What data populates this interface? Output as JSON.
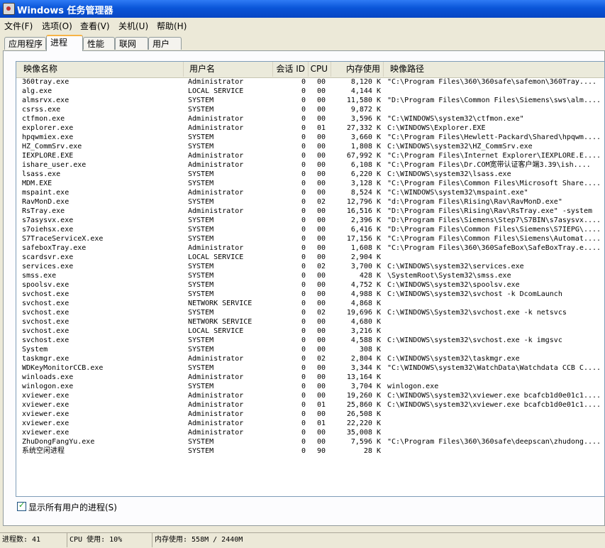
{
  "window": {
    "title": "Windows 任务管理器"
  },
  "menu": [
    "文件(F)",
    "选项(O)",
    "查看(V)",
    "关机(U)",
    "帮助(H)"
  ],
  "tabs": [
    "应用程序",
    "进程",
    "性能",
    "联网",
    "用户"
  ],
  "active_tab": "进程",
  "columns": [
    "映像名称",
    "用户名",
    "会话 ID",
    "CPU",
    "内存使用",
    "映像路径"
  ],
  "processes": [
    [
      "360tray.exe",
      "Administrator",
      "0",
      "00",
      "8,120 K",
      "\"C:\\Program Files\\360\\360safe\\safemon\\360Tray...."
    ],
    [
      "alg.exe",
      "LOCAL SERVICE",
      "0",
      "00",
      "4,144 K",
      ""
    ],
    [
      "almsrvx.exe",
      "SYSTEM",
      "0",
      "00",
      "11,580 K",
      "\"D:\\Program Files\\Common Files\\Siemens\\sws\\alm...."
    ],
    [
      "csrss.exe",
      "SYSTEM",
      "0",
      "00",
      "9,872 K",
      ""
    ],
    [
      "ctfmon.exe",
      "Administrator",
      "0",
      "00",
      "3,596 K",
      "\"C:\\WINDOWS\\system32\\ctfmon.exe\""
    ],
    [
      "explorer.exe",
      "Administrator",
      "0",
      "01",
      "27,332 K",
      "C:\\WINDOWS\\Explorer.EXE"
    ],
    [
      "hpqwmiex.exe",
      "SYSTEM",
      "0",
      "00",
      "3,660 K",
      "\"C:\\Program Files\\Hewlett-Packard\\Shared\\hpqwm...."
    ],
    [
      "HZ_CommSrv.exe",
      "SYSTEM",
      "0",
      "00",
      "1,808 K",
      "C:\\WINDOWS\\system32\\HZ_CommSrv.exe"
    ],
    [
      "IEXPLORE.EXE",
      "Administrator",
      "0",
      "00",
      "67,992 K",
      "\"C:\\Program Files\\Internet Explorer\\IEXPLORE.E...."
    ],
    [
      "ishare_user.exe",
      "Administrator",
      "0",
      "00",
      "6,108 K",
      "\"C:\\Program Files\\Dr.COM宽带认证客户端3.39\\ish...."
    ],
    [
      "lsass.exe",
      "SYSTEM",
      "0",
      "00",
      "6,220 K",
      "C:\\WINDOWS\\system32\\lsass.exe"
    ],
    [
      "MDM.EXE",
      "SYSTEM",
      "0",
      "00",
      "3,128 K",
      "\"C:\\Program Files\\Common Files\\Microsoft Share...."
    ],
    [
      "mspaint.exe",
      "Administrator",
      "0",
      "00",
      "8,524 K",
      "\"C:\\WINDOWS\\system32\\mspaint.exe\""
    ],
    [
      "RavMonD.exe",
      "SYSTEM",
      "0",
      "02",
      "12,796 K",
      "\"d:\\Program Files\\Rising\\Rav\\RavMonD.exe\""
    ],
    [
      "RsTray.exe",
      "Administrator",
      "0",
      "00",
      "16,516 K",
      "\"D:\\Program Files\\Rising\\Rav\\RsTray.exe\" -system"
    ],
    [
      "s7asysvx.exe",
      "SYSTEM",
      "0",
      "00",
      "2,396 K",
      "\"D:\\Program Files\\Siemens\\Step7\\S7BIN\\s7asysvx...."
    ],
    [
      "s7oiehsx.exe",
      "SYSTEM",
      "0",
      "00",
      "6,416 K",
      "\"D:\\Program Files\\Common Files\\Siemens\\S7IEPG\\...."
    ],
    [
      "S7TraceServiceX.exe",
      "SYSTEM",
      "0",
      "00",
      "17,156 K",
      "\"C:\\Program Files\\Common Files\\Siemens\\Automat...."
    ],
    [
      "safeboxTray.exe",
      "Administrator",
      "0",
      "00",
      "1,608 K",
      "\"C:\\Program Files\\360\\360SafeBox\\SafeBoxTray.e...."
    ],
    [
      "scardsvr.exe",
      "LOCAL SERVICE",
      "0",
      "00",
      "2,904 K",
      ""
    ],
    [
      "services.exe",
      "SYSTEM",
      "0",
      "02",
      "3,700 K",
      "C:\\WINDOWS\\system32\\services.exe"
    ],
    [
      "smss.exe",
      "SYSTEM",
      "0",
      "00",
      "428 K",
      "\\SystemRoot\\System32\\smss.exe"
    ],
    [
      "spoolsv.exe",
      "SYSTEM",
      "0",
      "00",
      "4,752 K",
      "C:\\WINDOWS\\system32\\spoolsv.exe"
    ],
    [
      "svchost.exe",
      "SYSTEM",
      "0",
      "00",
      "4,988 K",
      "C:\\WINDOWS\\system32\\svchost -k DcomLaunch"
    ],
    [
      "svchost.exe",
      "NETWORK SERVICE",
      "0",
      "00",
      "4,868 K",
      ""
    ],
    [
      "svchost.exe",
      "SYSTEM",
      "0",
      "02",
      "19,696 K",
      "C:\\WINDOWS\\System32\\svchost.exe -k netsvcs"
    ],
    [
      "svchost.exe",
      "NETWORK SERVICE",
      "0",
      "00",
      "4,680 K",
      ""
    ],
    [
      "svchost.exe",
      "LOCAL SERVICE",
      "0",
      "00",
      "3,216 K",
      ""
    ],
    [
      "svchost.exe",
      "SYSTEM",
      "0",
      "00",
      "4,588 K",
      "C:\\WINDOWS\\system32\\svchost.exe -k imgsvc"
    ],
    [
      "System",
      "SYSTEM",
      "0",
      "00",
      "308 K",
      ""
    ],
    [
      "taskmgr.exe",
      "Administrator",
      "0",
      "02",
      "2,804 K",
      "C:\\WINDOWS\\system32\\taskmgr.exe"
    ],
    [
      "WDKeyMonitorCCB.exe",
      "SYSTEM",
      "0",
      "00",
      "3,344 K",
      "\"C:\\WINDOWS\\system32\\WatchData\\Watchdata CCB C...."
    ],
    [
      "winloads.exe",
      "Administrator",
      "0",
      "00",
      "13,164 K",
      ""
    ],
    [
      "winlogon.exe",
      "SYSTEM",
      "0",
      "00",
      "3,704 K",
      "winlogon.exe"
    ],
    [
      "xviewer.exe",
      "Administrator",
      "0",
      "00",
      "19,260 K",
      "C:\\WINDOWS\\system32\\xviewer.exe bcafcb1d0e01c1...."
    ],
    [
      "xviewer.exe",
      "Administrator",
      "0",
      "01",
      "25,860 K",
      "C:\\WINDOWS\\system32\\xviewer.exe bcafcb1d0e01c1...."
    ],
    [
      "xviewer.exe",
      "Administrator",
      "0",
      "00",
      "26,508 K",
      ""
    ],
    [
      "xviewer.exe",
      "Administrator",
      "0",
      "01",
      "22,220 K",
      ""
    ],
    [
      "xviewer.exe",
      "Administrator",
      "0",
      "00",
      "35,008 K",
      ""
    ],
    [
      "ZhuDongFangYu.exe",
      "SYSTEM",
      "0",
      "00",
      "7,596 K",
      "\"C:\\Program Files\\360\\360safe\\deepscan\\zhudong...."
    ],
    [
      "系统空闲进程",
      "SYSTEM",
      "0",
      "90",
      "28 K",
      ""
    ]
  ],
  "show_all_users": {
    "label": "显示所有用户的进程(S)",
    "checked": true
  },
  "status": {
    "processes": "进程数: 41",
    "cpu": "CPU 使用: 10%",
    "memory": "内存使用: 558M / 2440M"
  }
}
